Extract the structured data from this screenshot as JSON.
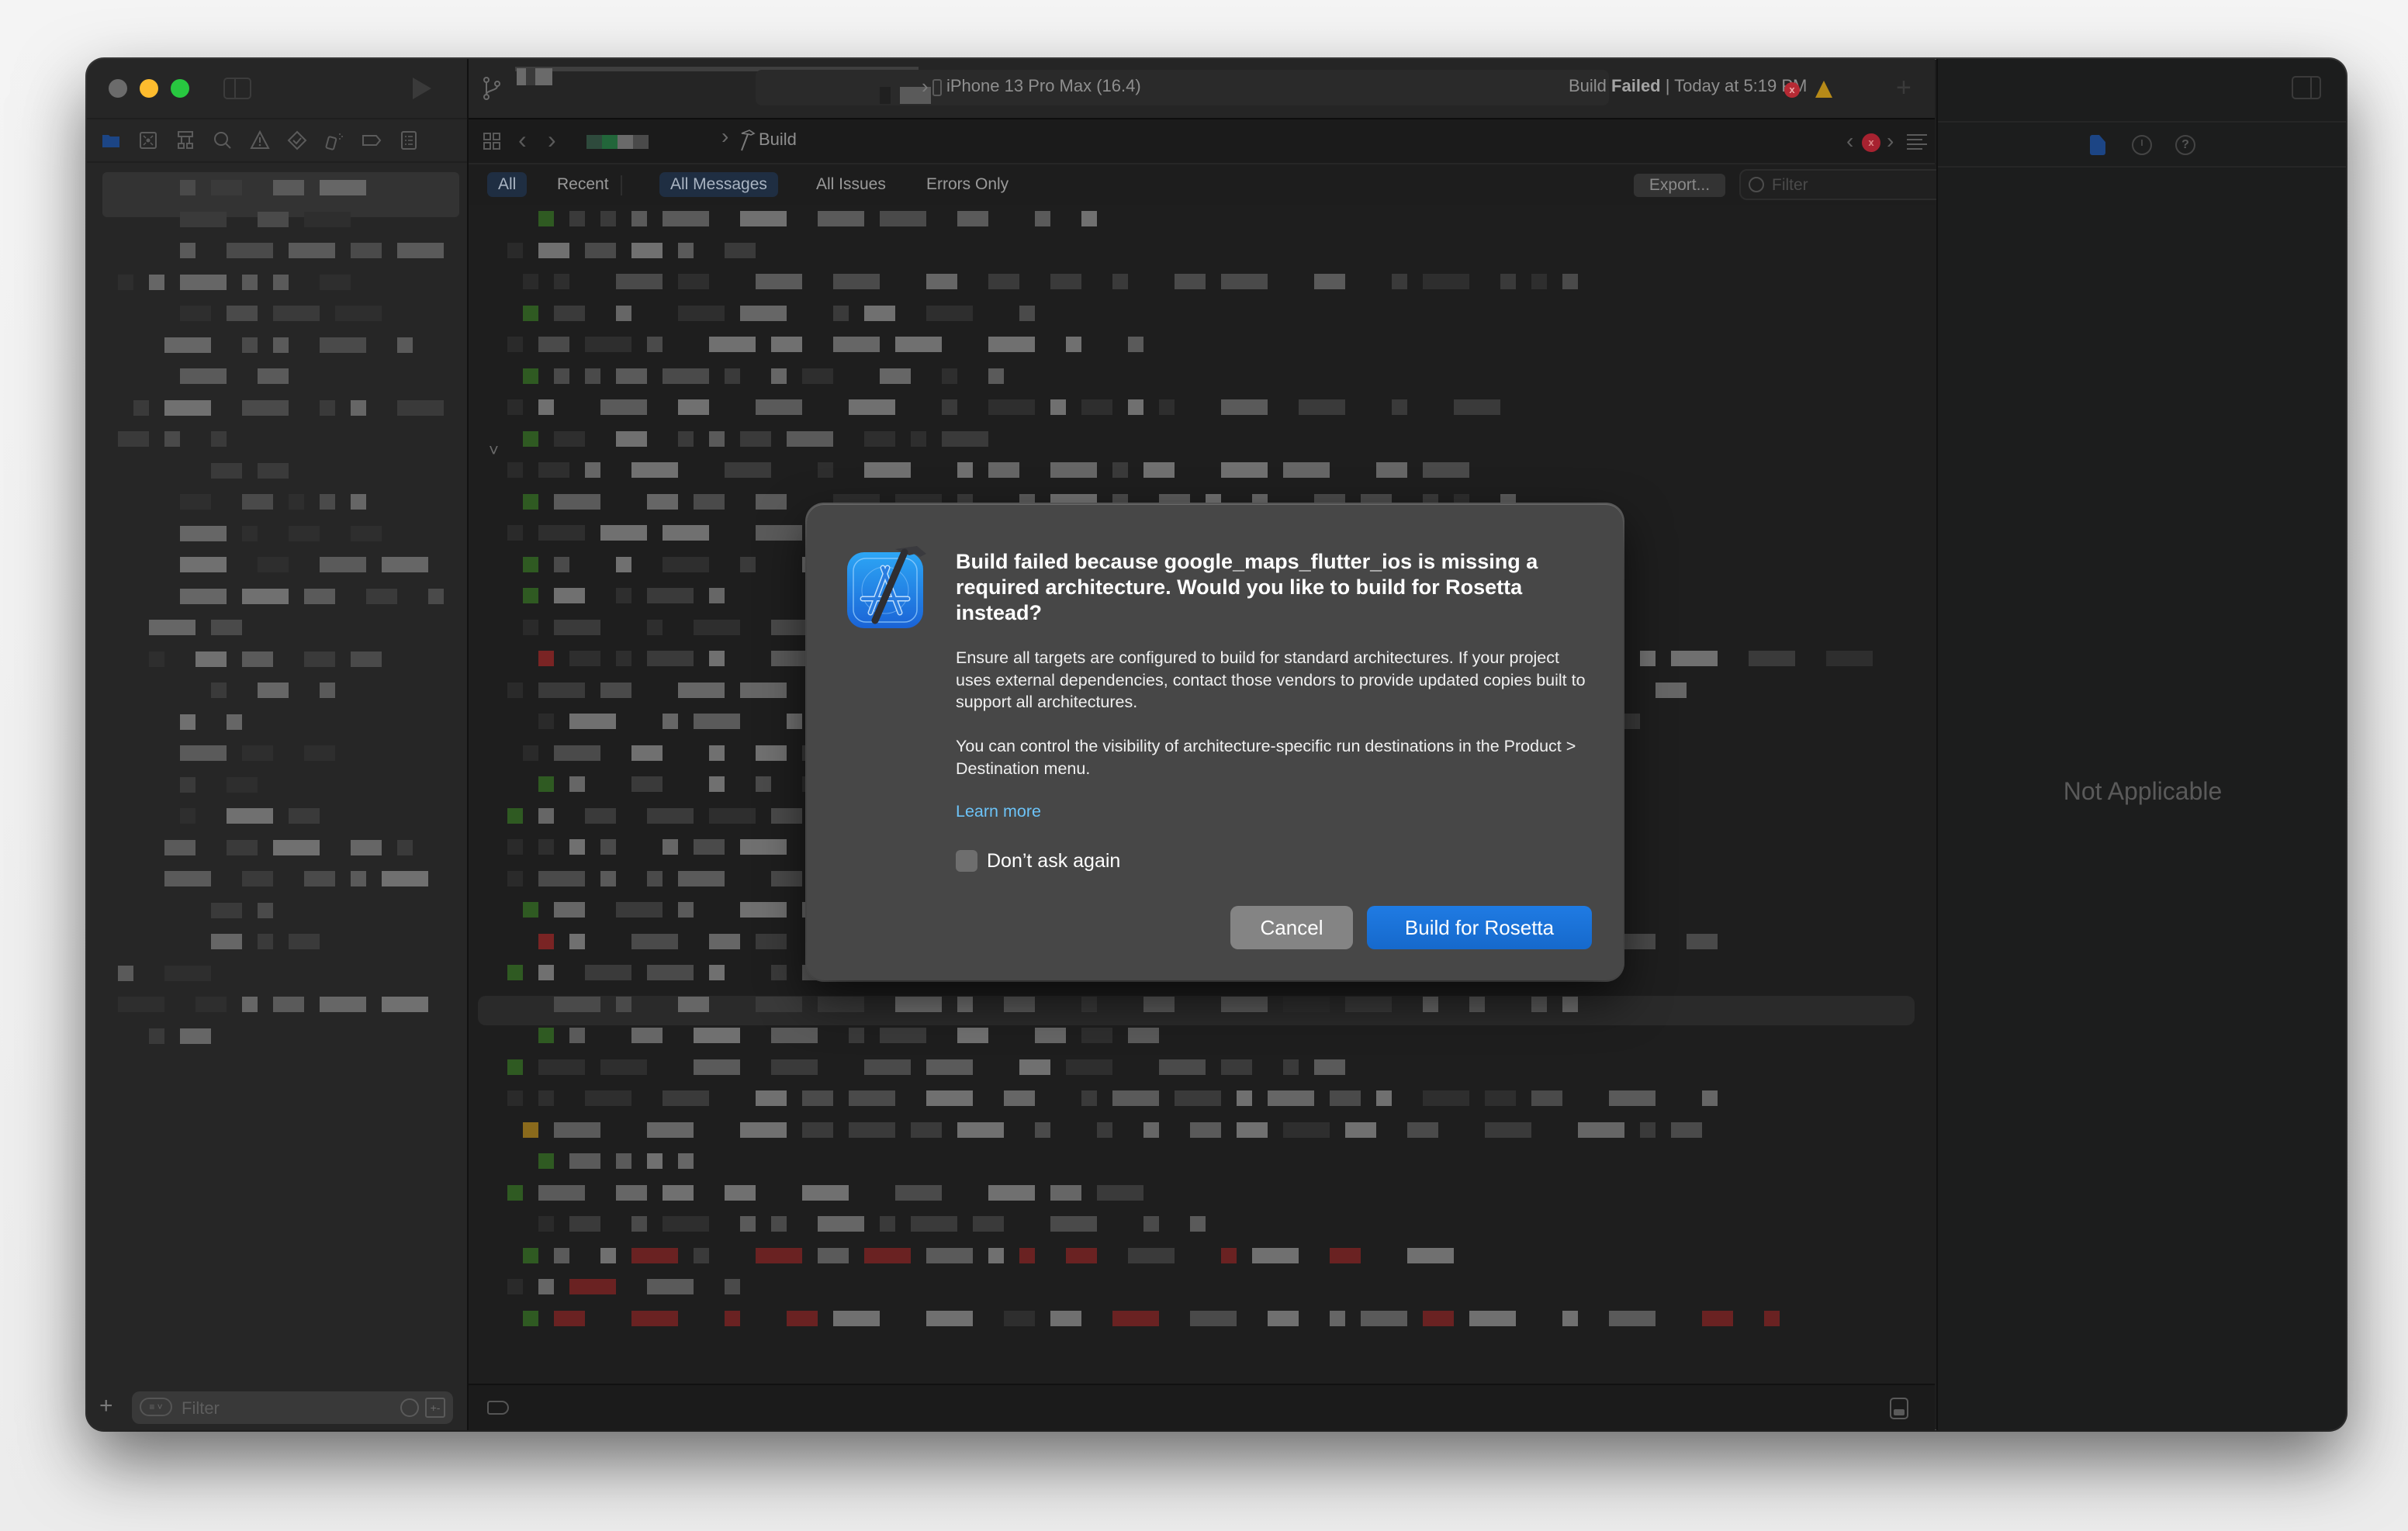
{
  "window": {
    "traffic_lights": [
      "close",
      "minimize",
      "zoom"
    ]
  },
  "toolbar": {
    "device": "iPhone 13 Pro Max (16.4)",
    "status_prefix": "Build ",
    "status_bold": "Failed",
    "status_suffix": " | Today at 5:19 PM",
    "error_badge": "x",
    "add_label": "+"
  },
  "navigator": {
    "tabs": [
      {
        "name": "project-navigator",
        "icon": "folder-icon",
        "active": true
      },
      {
        "name": "source-control-navigator",
        "icon": "source-control-icon"
      },
      {
        "name": "symbol-navigator",
        "icon": "hierarchy-icon"
      },
      {
        "name": "find-navigator",
        "icon": "search-icon"
      },
      {
        "name": "issue-navigator",
        "icon": "warning-icon"
      },
      {
        "name": "test-navigator",
        "icon": "diamond-check-icon"
      },
      {
        "name": "debug-navigator",
        "icon": "spray-icon"
      },
      {
        "name": "breakpoint-navigator",
        "icon": "tag-icon"
      },
      {
        "name": "report-navigator",
        "icon": "list-icon"
      }
    ],
    "filter_placeholder": "Filter",
    "add_label": "+",
    "filter_pm": "+-"
  },
  "jumpbar": {
    "crumb_last": "Build"
  },
  "log_filters": {
    "scope": [
      {
        "label": "All",
        "active": true
      },
      {
        "label": "Recent",
        "active": false
      }
    ],
    "types": [
      {
        "label": "All Messages",
        "active": true
      },
      {
        "label": "All Issues",
        "active": false
      },
      {
        "label": "Errors Only",
        "active": false
      }
    ],
    "export_label": "Export...",
    "filter_placeholder": "Filter"
  },
  "inspector": {
    "empty_label": "Not Applicable",
    "help_glyph": "?"
  },
  "dialog": {
    "title": "Build failed because google_maps_flutter_ios is missing a required architecture. Would you like to build for Rosetta instead?",
    "body1": "Ensure all targets are configured to build for standard architectures. If your project uses external dependencies, contact those vendors to provide updated copies built to support all architectures.",
    "body2": "You can control the visibility of architecture-specific run destinations in the Product > Destination menu.",
    "link": "Learn more",
    "checkbox_label": "Don’t ask again",
    "checkbox_checked": false,
    "cancel_label": "Cancel",
    "primary_label": "Build for Rosetta"
  },
  "colors": {
    "accent": "#1a74d8",
    "link": "#6cc3f7",
    "error": "#b62a34",
    "warning": "#b78a18",
    "traffic_close": "#6b6b6b",
    "traffic_min": "#febc2e",
    "traffic_max": "#28c840"
  }
}
